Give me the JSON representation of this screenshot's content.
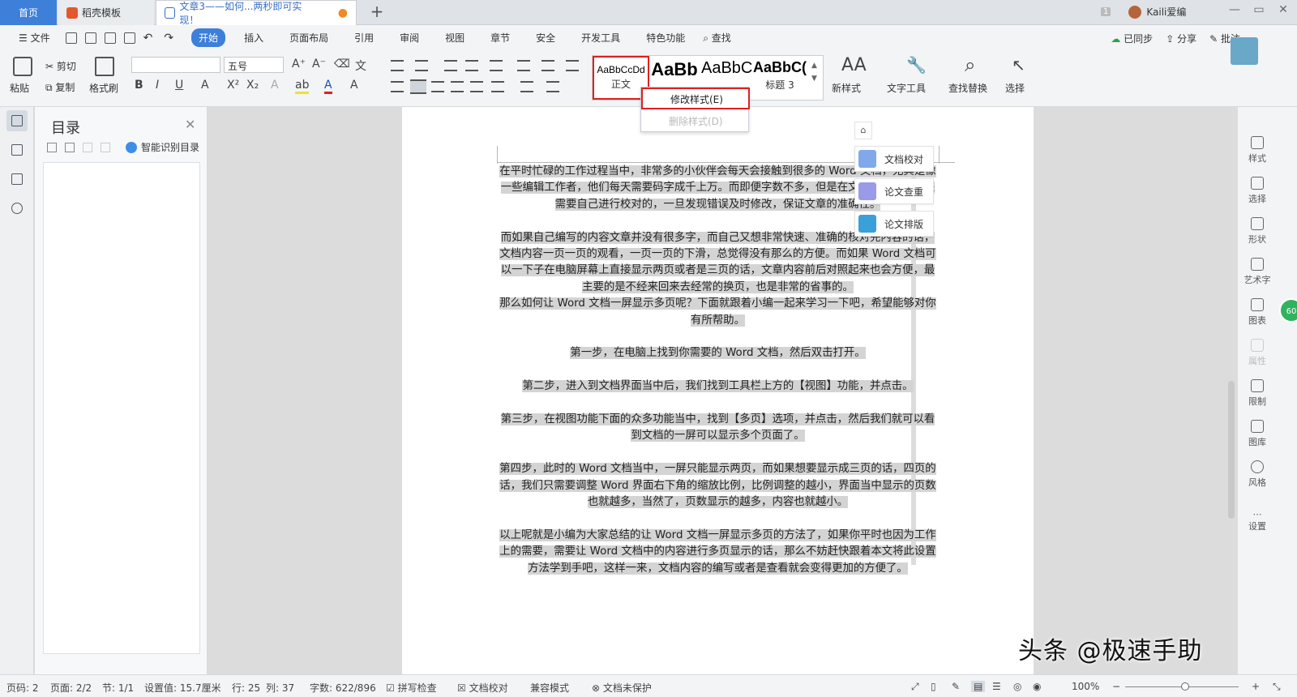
{
  "tabs": {
    "home": "首页",
    "template": "稻壳模板",
    "document": "文章3——如何...两秒即可实现！",
    "new_tab": "+"
  },
  "user": {
    "count": "1",
    "name": "Kaili爱编"
  },
  "window": {
    "minimize": "—",
    "restore": "▭",
    "close": "✕"
  },
  "menu": {
    "file": "☰ 文件",
    "items": [
      "开始",
      "插入",
      "页面布局",
      "引用",
      "审阅",
      "视图",
      "章节",
      "安全",
      "开发工具",
      "特色功能"
    ],
    "search": "查找",
    "sync": "已同步",
    "share": "分享",
    "comment": "批注"
  },
  "ribbon": {
    "paste": "粘贴",
    "cut": "剪切",
    "copy": "复制",
    "format_painter": "格式刷",
    "font_name": "",
    "font_size": "五号",
    "new_style": "新样式",
    "text_tools": "文字工具",
    "find_replace": "查找替换",
    "select": "选择"
  },
  "styles": {
    "previews": [
      "AaBbCcDd",
      "AaBb",
      "AaBbC",
      "AaBbC("
    ],
    "names": [
      "正文",
      "",
      "",
      "标题 3"
    ]
  },
  "context_menu": {
    "modify": "修改样式(E)",
    "delete": "删除样式(D)"
  },
  "toc": {
    "title": "目录",
    "smart": "智能识别目录"
  },
  "document": {
    "paragraphs": [
      "在平时忙碌的工作过程当中，非常多的小伙伴会每天会接触到很多的 Word 文档，尤其是像一些编辑工作者，他们每天需要码字成千上万。而即便字数不多，但是在文章的发布前也是需要自己进行校对的，一旦发现错误及时修改，保证文章的准确性。",
      "",
      "而如果自己编写的内容文章并没有很多字，而自己又想非常快速、准确的核对完内容的话，文档内容一页一页的观看，一页一页的下滑，总觉得没有那么的方便。而如果 Word 文档可以一下子在电脑屏幕上直接显示两页或者是三页的话，文章内容前后对照起来也会方便，最主要的是不经来回来去经常的换页，也是非常的省事的。",
      "那么如何让 Word 文档一屏显示多页呢？下面就跟着小编一起来学习一下吧，希望能够对你有所帮助。",
      "",
      "第一步，在电脑上找到你需要的 Word 文档，然后双击打开。",
      "",
      "第二步，进入到文档界面当中后，我们找到工具栏上方的【视图】功能，并点击。",
      "",
      "第三步，在视图功能下面的众多功能当中，找到【多页】选项，并点击，然后我们就可以看到文档的一屏可以显示多个页面了。",
      "",
      "第四步，此时的 Word 文档当中，一屏只能显示两页，而如果想要显示成三页的话，四页的话，我们只需要调整 Word 界面右下角的缩放比例，比例调整的越小，界面当中显示的页数也就越多，当然了，页数显示的越多，内容也就越小。",
      "",
      "以上呢就是小编为大家总结的让 Word 文档一屏显示多页的方法了，如果你平时也因为工作上的需要，需要让 Word 文档中的内容进行多页显示的话，那么不妨赶快跟着本文将此设置方法学到手吧，这样一来，文档内容的编写或者是查看就会变得更加的方便了。"
    ]
  },
  "float_panel": {
    "proofread": "文档校对",
    "paper_check": "论文查重",
    "paper_layout": "论文排版"
  },
  "right_rail": [
    "样式",
    "选择",
    "形状",
    "艺术字",
    "图表",
    "属性",
    "限制",
    "图库",
    "风格",
    "设置"
  ],
  "badge": "60",
  "watermark": "头条 @极速手助",
  "status": {
    "page": "页码: 2",
    "pages": "页面: 2/2",
    "section": "节: 1/1",
    "setting": "设置值: 15.7厘米",
    "row": "行: 25",
    "col": "列: 37",
    "words": "字数: 622/896",
    "spell": "拼写检查",
    "proof": "文档校对",
    "compat": "兼容模式",
    "protect": "文档未保护",
    "zoom": "100%"
  }
}
